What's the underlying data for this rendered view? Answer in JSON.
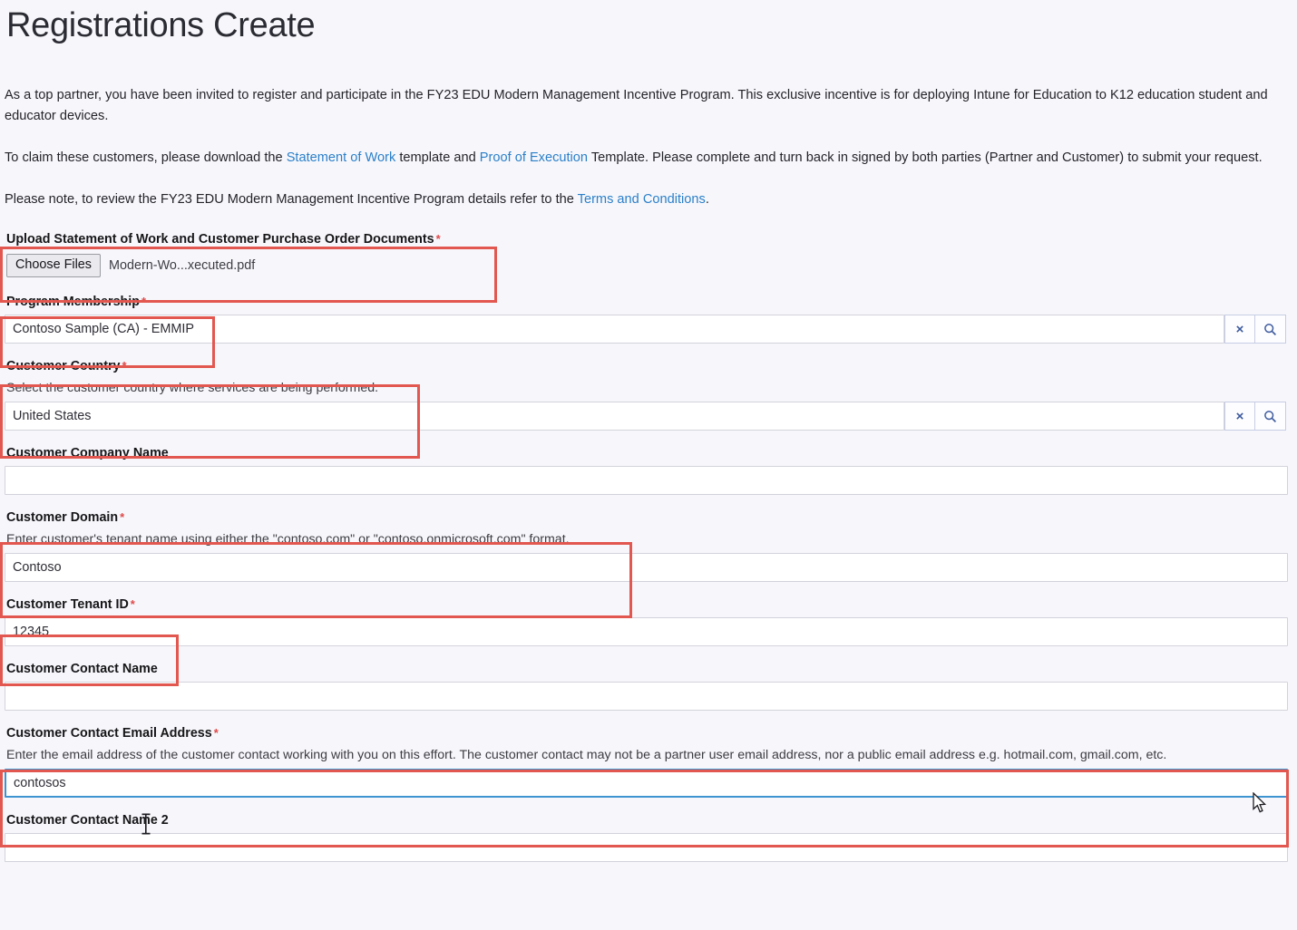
{
  "header": {
    "title": "Registrations Create"
  },
  "intro": {
    "para_1": "As a top partner, you have been invited to register and participate in the FY23 EDU Modern Management Incentive Program. This exclusive incentive is for deploying Intune for Education to K12 education student and educator devices.",
    "para_2_a": "To claim these customers, please download the ",
    "para_2_link_1": "Statement of Work",
    "para_2_b": " template and ",
    "para_2_link_2": "Proof of Execution",
    "para_2_c": " Template. Please complete and turn back in signed by both parties (Partner and Customer) to submit your request.",
    "para_3_a": "Please note, to review the FY23 EDU Modern Management Incentive Program details refer to the ",
    "para_3_link": "Terms and Conditions",
    "para_3_b": "."
  },
  "colors": {
    "link": "#2a7fc9",
    "required_asterisk": "#e04a4a",
    "highlight_box": "#e2574f",
    "focus_border": "#3d94d1",
    "lookup_icon": "#3d5a9e",
    "page_background": "#f7f7fb"
  },
  "fields": {
    "upload": {
      "label": "Upload Statement of Work and Customer Purchase Order Documents",
      "required": "*",
      "button_label": "Choose Files",
      "file_name": "Modern-Wo...xecuted.pdf",
      "highlighted": true
    },
    "program_membership": {
      "label": "Program Membership",
      "required": "*",
      "value": "Contoso Sample (CA) - EMMIP",
      "placeholder": "",
      "clear_icon": "close-x-icon",
      "search_icon": "magnifier-icon",
      "highlighted": true
    },
    "customer_country": {
      "label": "Customer Country",
      "required": "*",
      "help": "Select the customer country where services are being performed.",
      "value": "United States",
      "placeholder": "",
      "clear_icon": "close-x-icon",
      "search_icon": "magnifier-icon",
      "highlighted": true
    },
    "customer_company_name": {
      "label": "Customer Company Name",
      "required": "",
      "value": "",
      "placeholder": "",
      "highlighted": false
    },
    "customer_domain": {
      "label": "Customer Domain",
      "required": "*",
      "help": "Enter customer's tenant name using either the \"contoso.com\" or \"contoso.onmicrosoft.com\" format.",
      "value": "Contoso",
      "placeholder": "",
      "highlighted": true
    },
    "customer_tenant_id": {
      "label": "Customer Tenant ID",
      "required": "*",
      "value": "12345",
      "placeholder": "",
      "highlighted": true
    },
    "customer_contact_name": {
      "label": "Customer Contact Name",
      "required": "",
      "value": "",
      "placeholder": "",
      "highlighted": false
    },
    "customer_contact_email": {
      "label": "Customer Contact Email Address",
      "required": "*",
      "help": "Enter the email address of the customer contact working with you on this effort. The customer contact may not be a partner user email address, nor a public email address e.g. hotmail.com, gmail.com, etc.",
      "value": "contosos",
      "placeholder": "",
      "focused": true,
      "highlighted": true
    },
    "customer_contact_name_2": {
      "label": "Customer Contact Name 2",
      "required": "",
      "value": "",
      "placeholder": "",
      "highlighted": false
    }
  },
  "cursors": {
    "text_caret": "i-beam-cursor",
    "mouse_pointer": "mouse-arrow-cursor"
  }
}
